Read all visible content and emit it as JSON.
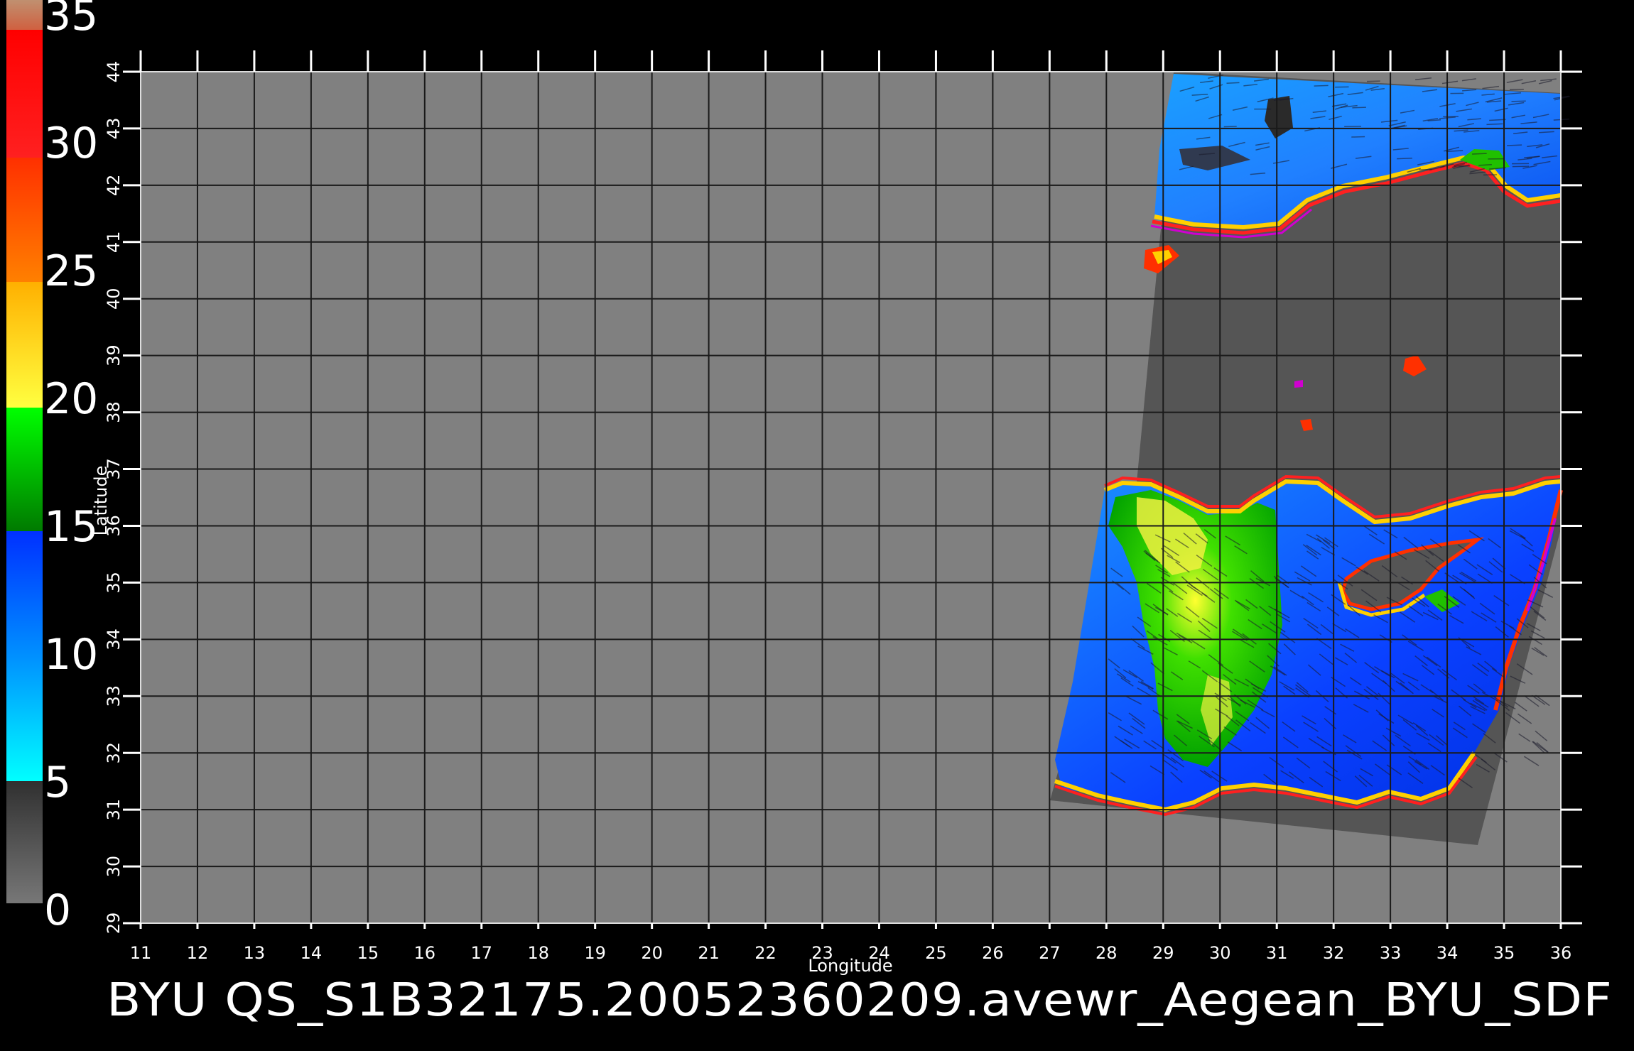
{
  "caption": "BYU QS_S1B32175.20052360209.avewr_Aegean_BYU_SDF",
  "axes": {
    "xlabel": "Longitude",
    "ylabel": "Latitude",
    "lon_range": [
      11,
      36
    ],
    "lat_range": [
      29,
      44
    ],
    "lon_ticks": [
      "11",
      "12",
      "13",
      "14",
      "15",
      "16",
      "17",
      "18",
      "19",
      "20",
      "21",
      "22",
      "23",
      "24",
      "25",
      "26",
      "27",
      "28",
      "29",
      "30",
      "31",
      "32",
      "33",
      "34",
      "35",
      "36"
    ],
    "lat_ticks": [
      "29",
      "30",
      "31",
      "32",
      "33",
      "34",
      "35",
      "36",
      "37",
      "38",
      "39",
      "40",
      "41",
      "42",
      "43",
      "44"
    ]
  },
  "colorbar": {
    "labels": [
      "0",
      "5",
      "10",
      "15",
      "20",
      "25",
      "30",
      "35"
    ],
    "range": [
      0,
      35
    ],
    "colors": {
      "gray_low": "#777777",
      "gray_high": "#303030",
      "cyan": "#00ffff",
      "blue": "#0030ff",
      "green_dark": "#007a00",
      "green": "#00ff00",
      "yellow": "#ffff00",
      "orange": "#ff8000",
      "red": "#ff1a1a",
      "brown": "#c08060"
    }
  },
  "map": {
    "background": "#808080",
    "no_data": "#555555",
    "grid_color": "#1a1a1a"
  }
}
